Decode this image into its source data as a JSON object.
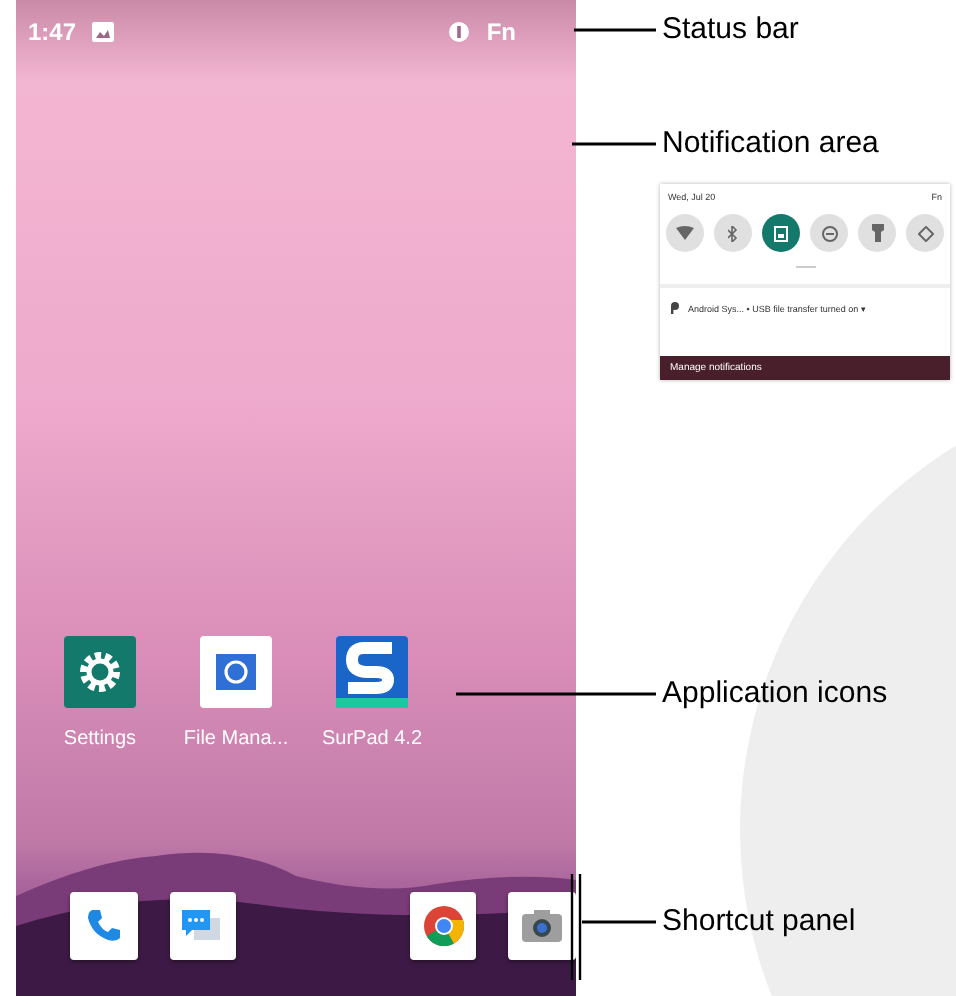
{
  "status_bar": {
    "time": "1:47",
    "indicator": "Fn"
  },
  "notification_preview": {
    "date": "Wed, Jul 20",
    "indicator": "Fn",
    "quick_settings": [
      {
        "kind": "wifi",
        "on": false
      },
      {
        "kind": "bluetooth",
        "on": false
      },
      {
        "kind": "transfer",
        "on": true
      },
      {
        "kind": "dnd",
        "on": false
      },
      {
        "kind": "flashlight",
        "on": false
      },
      {
        "kind": "rotate",
        "on": false
      }
    ],
    "notification": "Android Sys... • USB file transfer turned on ▾",
    "footer": "Manage notifications"
  },
  "apps": [
    {
      "kind": "settings",
      "label": "Settings"
    },
    {
      "kind": "files",
      "label": "File Mana..."
    },
    {
      "kind": "surpad",
      "label": "SurPad 4.2"
    }
  ],
  "dock": [
    {
      "kind": "phone"
    },
    {
      "kind": "messages"
    },
    {
      "kind": "chrome"
    },
    {
      "kind": "camera"
    }
  ],
  "callouts": [
    {
      "kind": "status",
      "label": "Status bar"
    },
    {
      "kind": "notifications",
      "label": "Notification area"
    },
    {
      "kind": "apps",
      "label": "Application icons"
    },
    {
      "kind": "dock",
      "label": "Shortcut panel"
    }
  ]
}
